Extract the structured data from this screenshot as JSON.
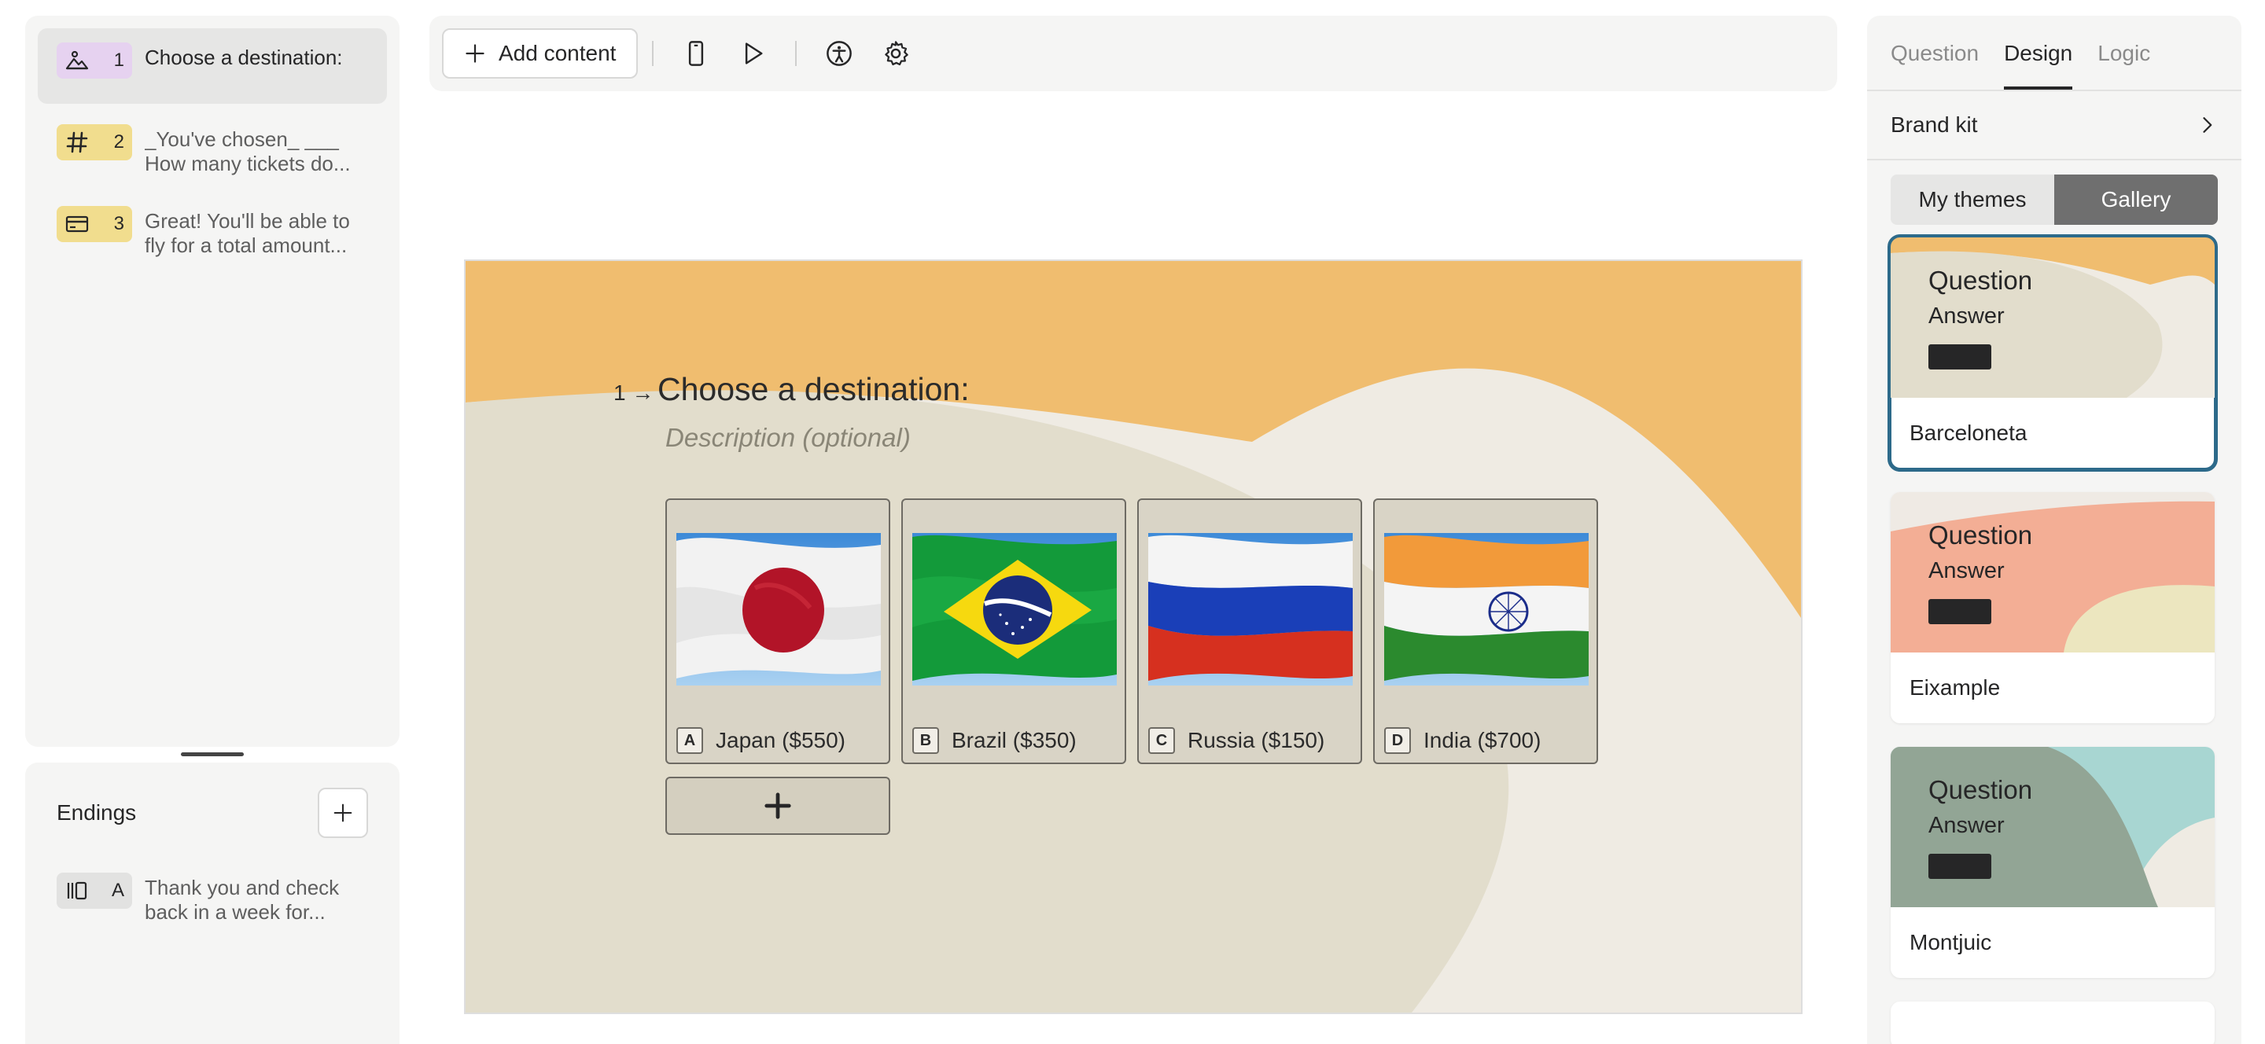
{
  "sidebar": {
    "questions": [
      {
        "number": "1",
        "text": "Choose a destination:",
        "icon": "picture-choice-icon",
        "badge_color": "#e6d2f0"
      },
      {
        "number": "2",
        "text": "_You've chosen_ ___ How many tickets do...",
        "icon": "hash-icon",
        "badge_color": "#f1dd8e"
      },
      {
        "number": "3",
        "text": "Great! You'll be able to fly for a total amount...",
        "icon": "credit-card-icon",
        "badge_color": "#f1dd8e"
      }
    ],
    "endings": {
      "title": "Endings",
      "items": [
        {
          "key": "A",
          "text": "Thank you and check back in a week for...",
          "icon": "ending-icon"
        }
      ]
    }
  },
  "toolbar": {
    "add_content_label": "Add content",
    "icons": [
      "mobile-preview-icon",
      "play-icon",
      "accessibility-icon",
      "settings-icon"
    ]
  },
  "canvas": {
    "question_number": "1",
    "question_title": "Choose a destination:",
    "description_placeholder": "Description (optional)",
    "choices": [
      {
        "key": "A",
        "label": "Japan ($550)",
        "flag": "japan-flag"
      },
      {
        "key": "B",
        "label": "Brazil ($350)",
        "flag": "brazil-flag"
      },
      {
        "key": "C",
        "label": "Russia ($150)",
        "flag": "russia-flag"
      },
      {
        "key": "D",
        "label": "India ($700)",
        "flag": "india-flag"
      }
    ],
    "colors": {
      "bg_top": "#f0bd6f",
      "wave_light": "#efebe3",
      "wave_main": "#e2ddcc"
    }
  },
  "right_panel": {
    "tabs": [
      {
        "label": "Question",
        "active": false
      },
      {
        "label": "Design",
        "active": true
      },
      {
        "label": "Logic",
        "active": false
      }
    ],
    "brand_kit_label": "Brand kit",
    "segments": [
      {
        "label": "My themes",
        "active": false
      },
      {
        "label": "Gallery",
        "active": true
      }
    ],
    "themes": [
      {
        "name": "Barceloneta",
        "question": "Question",
        "answer": "Answer",
        "selected": true
      },
      {
        "name": "Eixample",
        "question": "Question",
        "answer": "Answer",
        "selected": false
      },
      {
        "name": "Montjuic",
        "question": "Question",
        "answer": "Answer",
        "selected": false
      }
    ]
  }
}
